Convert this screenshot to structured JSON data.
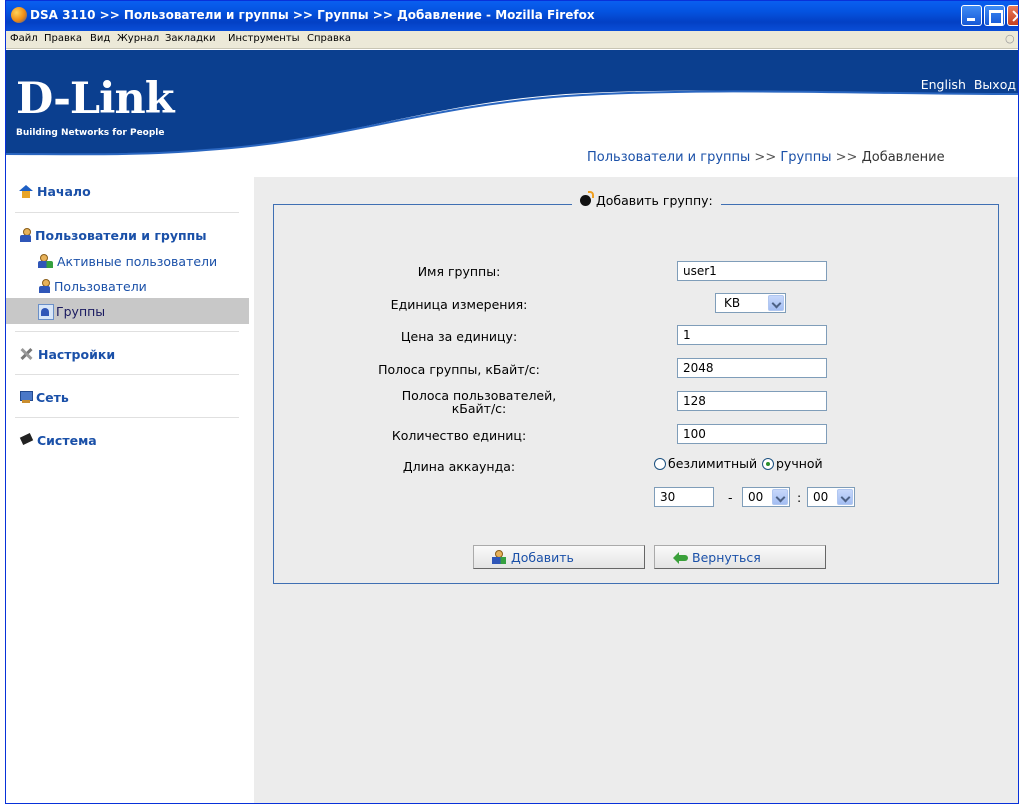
{
  "window": {
    "title": "DSA 3110 >> Пользователи и группы >> Группы >> Добавление - Mozilla Firefox"
  },
  "menubar": {
    "items": [
      "Файл",
      "Правка",
      "Вид",
      "Журнал",
      "Закладки",
      "Инструменты",
      "Справка"
    ]
  },
  "header": {
    "logo": "D-Link",
    "tagline": "Building Networks for People",
    "links": [
      "English",
      "Выход"
    ],
    "breadcrumb": {
      "part1": "Пользователи и группы",
      "sep": ">>",
      "part2": "Группы",
      "current": "Добавление"
    },
    "colors": {
      "band": "#0b3f8f",
      "accent": "#1a50a8"
    }
  },
  "sidebar": {
    "home": {
      "label": "Начало",
      "icon": "home-icon"
    },
    "users_groups": {
      "label": "Пользователи и группы",
      "icon": "user-icon",
      "children": [
        {
          "label": "Активные пользователи",
          "icon": "active-users-icon"
        },
        {
          "label": "Пользователи",
          "icon": "user-icon"
        },
        {
          "label": "Группы",
          "icon": "group-icon",
          "selected": true
        }
      ]
    },
    "settings": {
      "label": "Настройки",
      "icon": "tools-icon"
    },
    "network": {
      "label": "Сеть",
      "icon": "network-icon"
    },
    "system": {
      "label": "Система",
      "icon": "system-icon"
    }
  },
  "form": {
    "legend": "Добавить группу:",
    "group_name": {
      "label": "Имя группы:",
      "value": "user1"
    },
    "unit": {
      "label": "Единица измерения:",
      "value": "KB"
    },
    "unit_price": {
      "label": "Цена за единицу:",
      "value": "1"
    },
    "group_bandwidth": {
      "label": "Полоса группы, кБайт/с:",
      "value": "2048"
    },
    "user_bandwidth": {
      "label": "Полоса пользователей, кБайт/с:",
      "value": "128"
    },
    "unit_count": {
      "label": "Количество единиц:",
      "value": "100"
    },
    "account_length": {
      "label": "Длина аккаунда:",
      "options": [
        "безлимитный",
        "ручной"
      ],
      "selected": "ручной",
      "days": "30",
      "dash": "-",
      "hours": "00",
      "colon": ":",
      "minutes": "00"
    },
    "buttons": {
      "add": "Добавить",
      "back": "Вернуться"
    }
  }
}
